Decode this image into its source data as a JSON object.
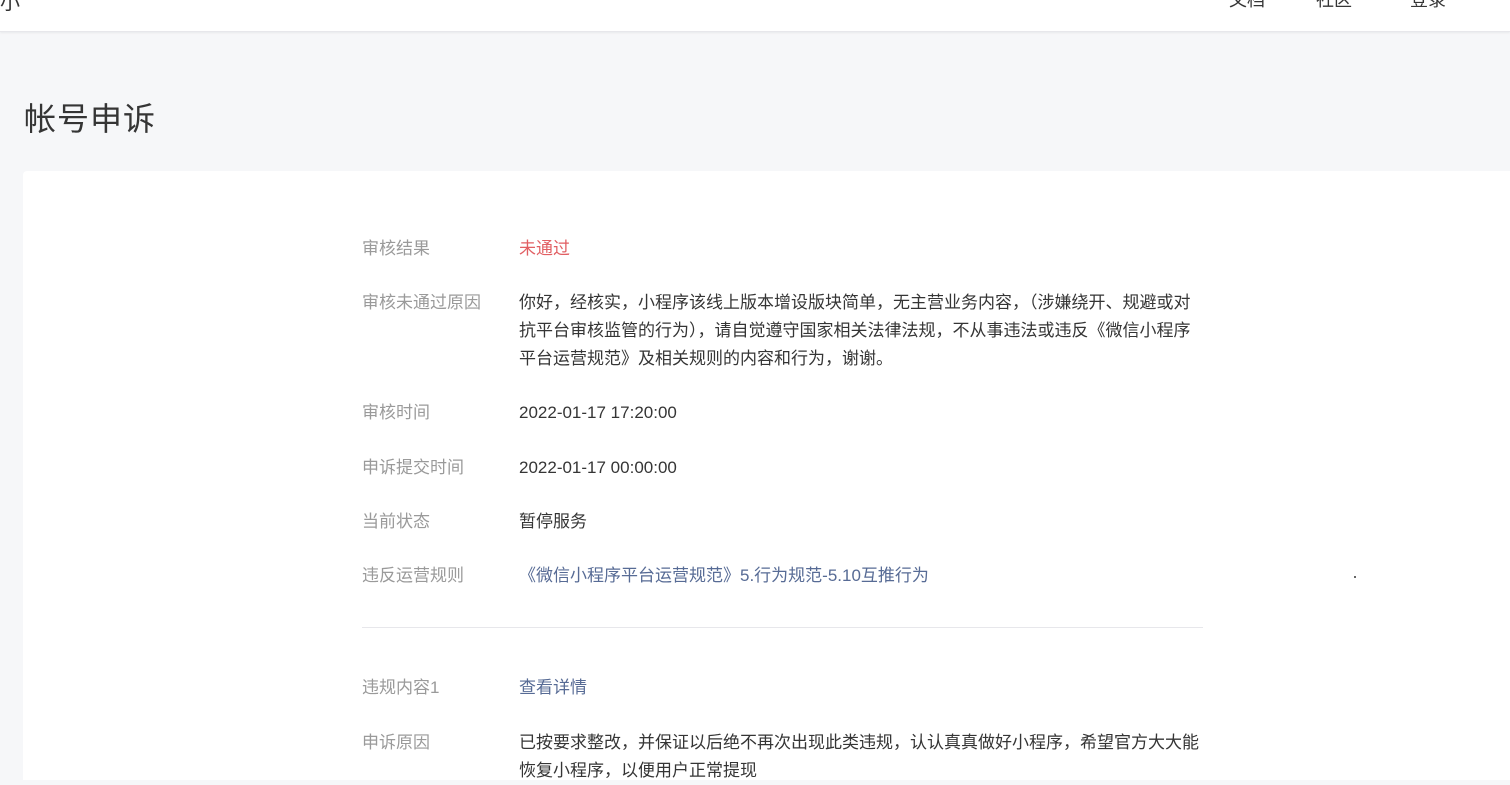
{
  "header": {
    "logo_fragment": "小",
    "nav": [
      "文档",
      "社区",
      "登录"
    ]
  },
  "page_title": "帐号申诉",
  "details": [
    {
      "label": "审核结果",
      "value": "未通过"
    },
    {
      "label": "审核未通过原因",
      "value": "你好，经核实，小程序该线上版本增设版块简单，无主营业务内容，（涉嫌绕开、规避或对抗平台审核监管的行为），请自觉遵守国家相关法律法规，不从事违法或违反《微信小程序平台运营规范》及相关规则的内容和行为，谢谢。"
    },
    {
      "label": "审核时间",
      "value": "2022-01-17 17:20:00"
    },
    {
      "label": "申诉提交时间",
      "value": "2022-01-17 00:00:00"
    },
    {
      "label": "当前状态",
      "value": "暂停服务"
    },
    {
      "label": "违反运营规则",
      "value": "《微信小程序平台运营规范》5.行为规范-5.10互推行为"
    }
  ],
  "violations": [
    {
      "label": "违规内容1",
      "value": "查看详情"
    },
    {
      "label": "申诉原因",
      "value": "已按要求整改，并保证以后绝不再次出现此类违规，认认真真做好小程序，希望官方大大能恢复小程序，以便用户正常提现"
    }
  ],
  "colors": {
    "danger": "#e15f63",
    "link": "#576b95",
    "label": "#9a9a9a",
    "text": "#353535",
    "background": "#f6f7f9"
  }
}
